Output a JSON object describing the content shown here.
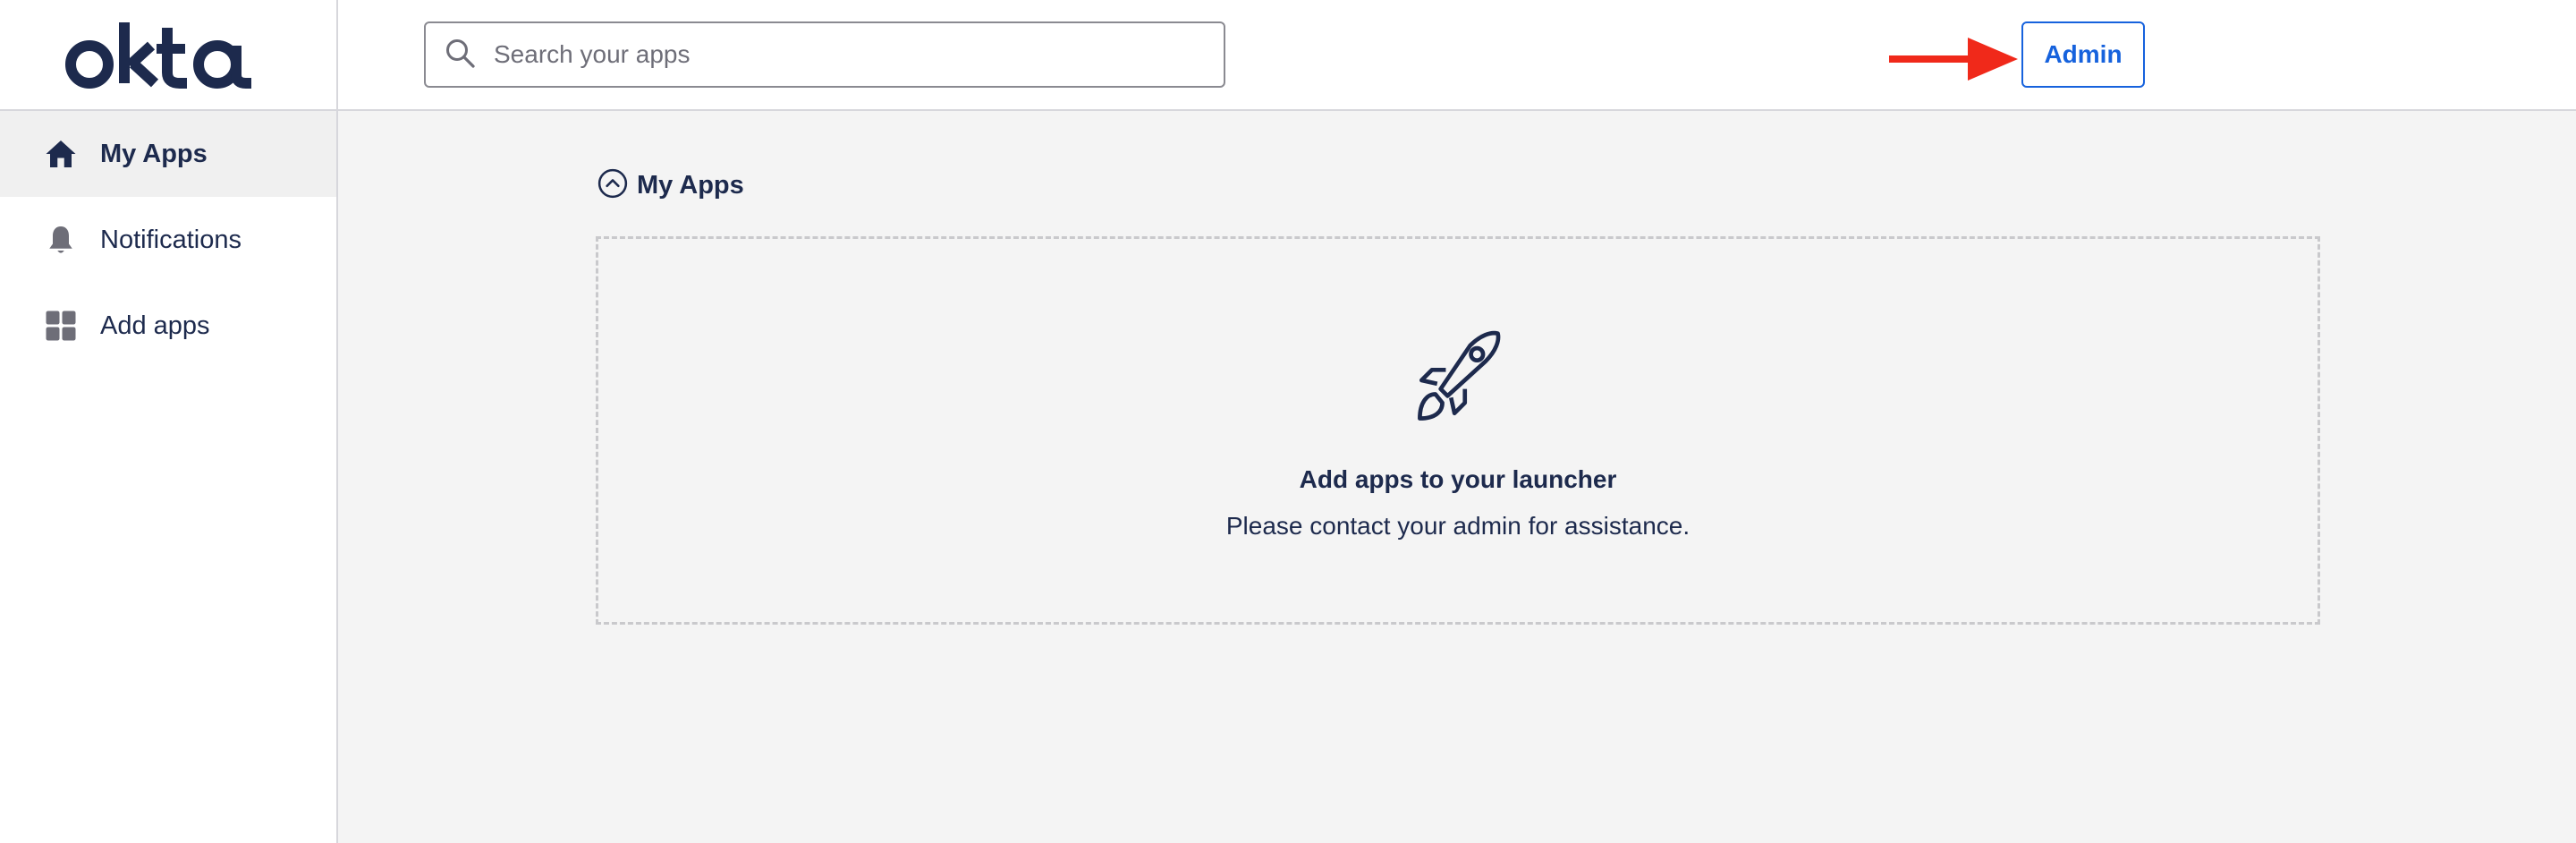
{
  "brand": {
    "logo_text": "okta",
    "logo_color": "#1d2a4d"
  },
  "sidebar": {
    "items": [
      {
        "label": "My Apps",
        "icon": "home-icon",
        "active": true
      },
      {
        "label": "Notifications",
        "icon": "bell-icon",
        "active": false
      },
      {
        "label": "Add apps",
        "icon": "grid-icon",
        "active": false
      }
    ]
  },
  "header": {
    "search": {
      "placeholder": "Search your apps",
      "value": "",
      "icon": "search-icon"
    },
    "admin_label": "Admin",
    "annotation_arrow_color": "#f0291a"
  },
  "main": {
    "section_title": "My Apps",
    "section_icon": "chevron-up-circle-icon",
    "empty_state": {
      "icon": "rocket-icon",
      "title": "Add apps to your launcher",
      "subtitle": "Please contact your admin for assistance."
    }
  },
  "colors": {
    "accent": "#1662dd",
    "text": "#1d2a4d",
    "background": "#f4f4f4"
  }
}
